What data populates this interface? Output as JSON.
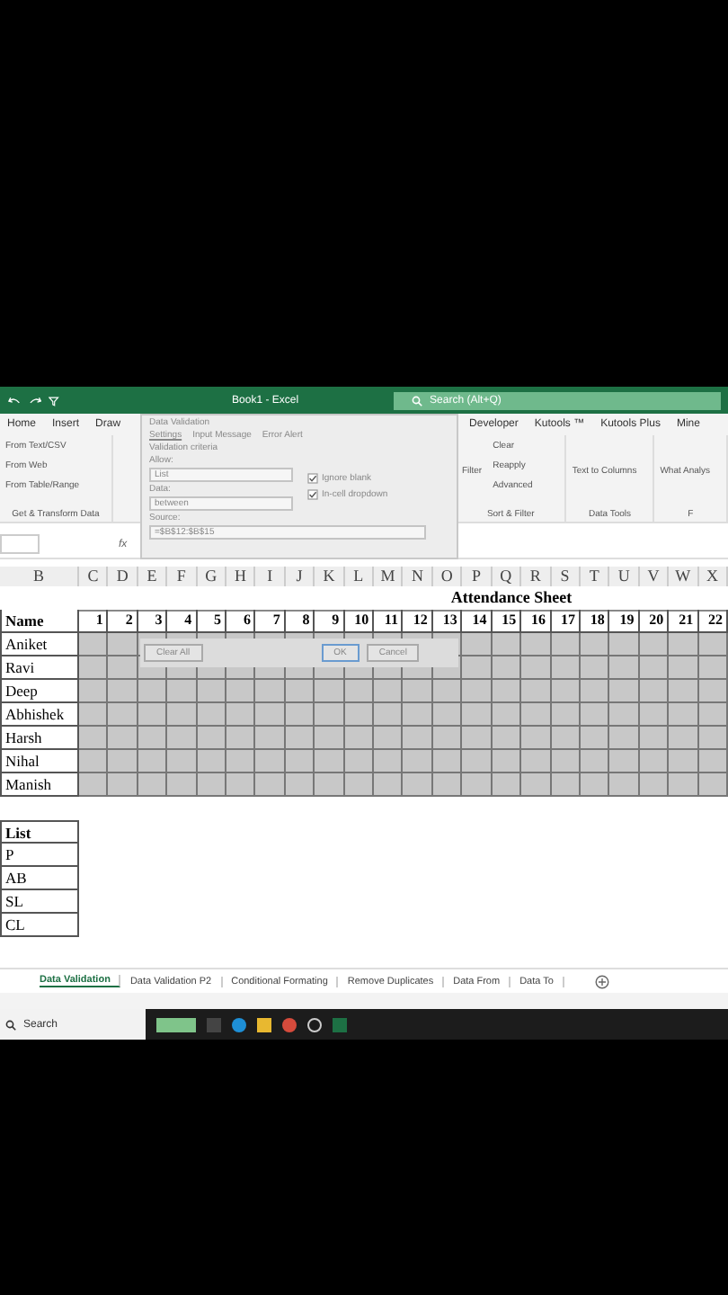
{
  "window": {
    "title": "Book1 - Excel",
    "search": {
      "placeholder": "Search (Alt+Q)"
    }
  },
  "ribbon_tabs": [
    "Home",
    "Insert",
    "Draw",
    "Developer",
    "Kutools ™",
    "Kutools Plus",
    "Mine"
  ],
  "ribbon_groups": [
    {
      "title": "Get & Transform Data",
      "items": [
        "From Text/CSV",
        "From Web",
        "From Table/Range"
      ]
    },
    {
      "title": "Sort & Filter",
      "items": [
        "Clear",
        "Reapply",
        "Advanced"
      ],
      "extra": [
        "Filter"
      ]
    },
    {
      "title": "Data Tools",
      "extra": [
        "Text to Columns"
      ]
    },
    {
      "title": "F",
      "extra": [
        "What Analys"
      ]
    }
  ],
  "formula_bar": {
    "function_label": "fx"
  },
  "columns": [
    "B",
    "C",
    "D",
    "E",
    "F",
    "G",
    "H",
    "I",
    "J",
    "K",
    "L",
    "M",
    "N",
    "O",
    "P",
    "Q",
    "R",
    "S",
    "T",
    "U",
    "V",
    "W",
    "X"
  ],
  "sheet": {
    "title": "Attendance Sheet",
    "name_header": "Name",
    "days": [
      "1",
      "2",
      "3",
      "4",
      "5",
      "6",
      "7",
      "8",
      "9",
      "10",
      "11",
      "12",
      "13",
      "14",
      "15",
      "16",
      "17",
      "18",
      "19",
      "20",
      "21",
      "22"
    ],
    "names": [
      "Aniket",
      "Ravi",
      "Deep",
      "Abhishek",
      "Harsh",
      "Nihal",
      "Manish"
    ]
  },
  "list": {
    "header": "List",
    "items": [
      "P",
      "AB",
      "SL",
      "CL"
    ]
  },
  "dialog": {
    "title": "Data Validation",
    "tabs": [
      {
        "label": "Settings",
        "selected": true
      },
      {
        "label": "Input Message",
        "selected": false
      },
      {
        "label": "Error Alert",
        "selected": false
      }
    ],
    "criteria_label": "Validation criteria",
    "allow_label": "Allow:",
    "allow_value": "List",
    "data_label": "Data:",
    "data_value": "between",
    "checks": [
      {
        "label": "Ignore blank",
        "checked": true
      },
      {
        "label": "In-cell dropdown",
        "checked": true
      }
    ],
    "source_label": "Source:",
    "source_value": "=$B$12:$B$15",
    "buttons": [
      "Clear All",
      "OK",
      "Cancel"
    ]
  },
  "sheet_tabs": [
    {
      "label": "Data Validation",
      "selected": true
    },
    {
      "label": "Data Validation P2",
      "selected": false
    },
    {
      "label": "Conditional Formating",
      "selected": false
    },
    {
      "label": "Remove Duplicates",
      "selected": false
    },
    {
      "label": "Data From",
      "selected": false
    },
    {
      "label": "Data To",
      "selected": false
    }
  ],
  "taskbar": {
    "search": "Search"
  }
}
